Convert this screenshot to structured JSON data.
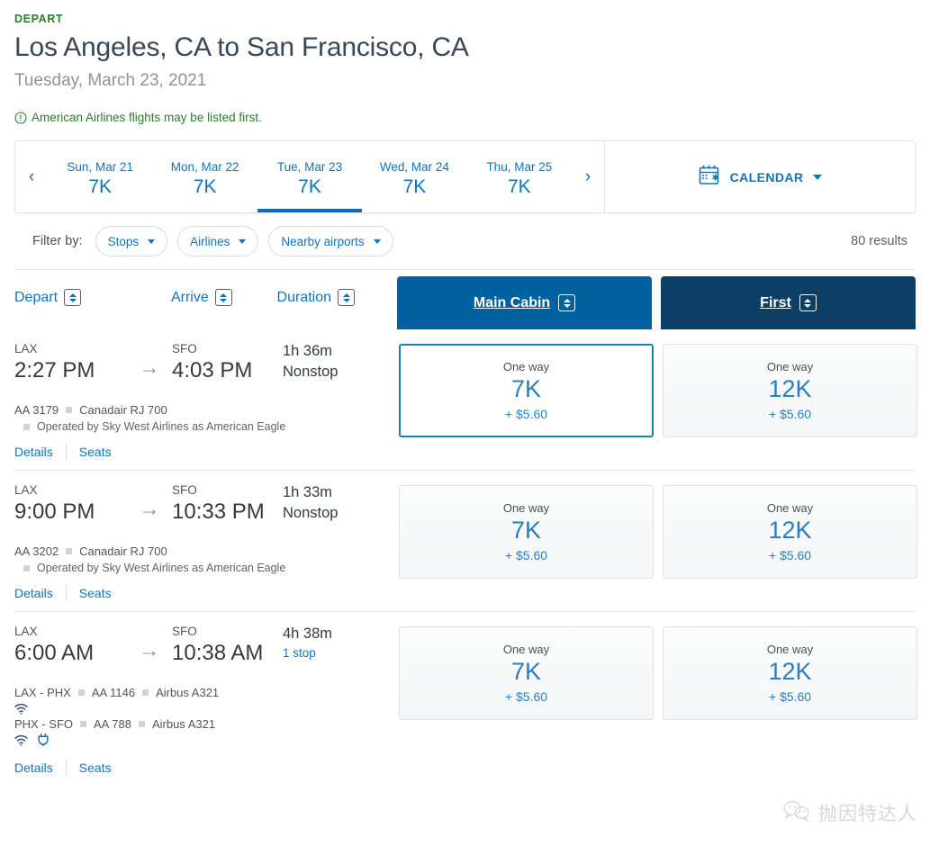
{
  "header": {
    "depart_label": "DEPART",
    "route_title": "Los Angeles, CA to San Francisco, CA",
    "route_date": "Tuesday, March 23, 2021",
    "notice_text": "American Airlines flights may be listed first.",
    "notice_icon": "info-circle-icon",
    "notice_color": "#2a7d2e"
  },
  "datebar": {
    "prev_arrow": "‹",
    "next_arrow": "›",
    "calendar_icon": "calendar-icon",
    "calendar_label": "CALENDAR",
    "dates": [
      {
        "label": "Sun, Mar 21",
        "price": "7K",
        "active": false
      },
      {
        "label": "Mon, Mar 22",
        "price": "7K",
        "active": false
      },
      {
        "label": "Tue, Mar 23",
        "price": "7K",
        "active": true
      },
      {
        "label": "Wed, Mar 24",
        "price": "7K",
        "active": false
      },
      {
        "label": "Thu, Mar 25",
        "price": "7K",
        "active": false
      }
    ]
  },
  "filters": {
    "filter_by_label": "Filter by:",
    "chips": [
      {
        "label": "Stops"
      },
      {
        "label": "Airlines"
      },
      {
        "label": "Nearby airports"
      }
    ],
    "results_text": "80 results"
  },
  "columns": {
    "depart": "Depart",
    "arrive": "Arrive",
    "duration": "Duration",
    "cabins": [
      {
        "label": "Main Cabin",
        "color": "#0061a0"
      },
      {
        "label": "First",
        "color": "#0d3f66"
      }
    ]
  },
  "flights": [
    {
      "depart_airport": "LAX",
      "depart_time": "2:27 PM",
      "arrive_airport": "SFO",
      "arrive_time": "4:03 PM",
      "duration": "1h 36m",
      "stops": "Nonstop",
      "stops_is_link": false,
      "segments": [
        {
          "route": "",
          "flight_no": "AA 3179",
          "aircraft": "Canadair RJ 700",
          "amenities": []
        }
      ],
      "operated_by": "Operated by Sky West Airlines as American Eagle",
      "details_label": "Details",
      "seats_label": "Seats",
      "prices": [
        {
          "kind": "One way",
          "value": "7K",
          "tax": "+ $5.60",
          "selected": true
        },
        {
          "kind": "One way",
          "value": "12K",
          "tax": "+ $5.60",
          "selected": false
        }
      ]
    },
    {
      "depart_airport": "LAX",
      "depart_time": "9:00 PM",
      "arrive_airport": "SFO",
      "arrive_time": "10:33 PM",
      "duration": "1h 33m",
      "stops": "Nonstop",
      "stops_is_link": false,
      "segments": [
        {
          "route": "",
          "flight_no": "AA 3202",
          "aircraft": "Canadair RJ 700",
          "amenities": []
        }
      ],
      "operated_by": "Operated by Sky West Airlines as American Eagle",
      "details_label": "Details",
      "seats_label": "Seats",
      "prices": [
        {
          "kind": "One way",
          "value": "7K",
          "tax": "+ $5.60",
          "selected": false
        },
        {
          "kind": "One way",
          "value": "12K",
          "tax": "+ $5.60",
          "selected": false
        }
      ]
    },
    {
      "depart_airport": "LAX",
      "depart_time": "6:00 AM",
      "arrive_airport": "SFO",
      "arrive_time": "10:38 AM",
      "duration": "4h 38m",
      "stops": "1 stop",
      "stops_is_link": true,
      "segments": [
        {
          "route": "LAX - PHX",
          "flight_no": "AA 1146",
          "aircraft": "Airbus A321",
          "amenities": [
            "wifi-icon"
          ]
        },
        {
          "route": "PHX - SFO",
          "flight_no": "AA 788",
          "aircraft": "Airbus A321",
          "amenities": [
            "wifi-icon",
            "power-outlet-icon"
          ]
        }
      ],
      "operated_by": "",
      "details_label": "Details",
      "seats_label": "Seats",
      "prices": [
        {
          "kind": "One way",
          "value": "7K",
          "tax": "+ $5.60",
          "selected": false
        },
        {
          "kind": "One way",
          "value": "12K",
          "tax": "+ $5.60",
          "selected": false
        }
      ]
    }
  ],
  "watermark": {
    "icon": "wechat-icon",
    "text": "抛因特达人"
  }
}
